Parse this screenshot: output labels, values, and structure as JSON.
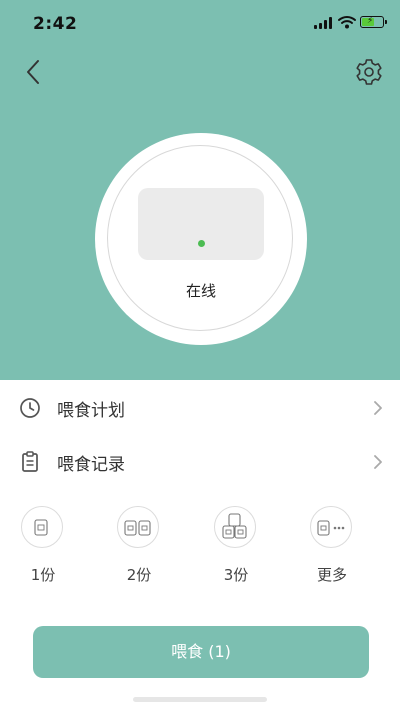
{
  "status_bar": {
    "time": "2:42",
    "icons": [
      "signal-icon",
      "wifi-icon",
      "battery-charging-icon"
    ]
  },
  "header": {
    "back_icon": "back-icon",
    "settings_icon": "gear-icon",
    "accent_color": "#7cbfb1"
  },
  "device": {
    "status": "在线",
    "led_color": "#4cbc52"
  },
  "menu": [
    {
      "label": "喂食计划",
      "icon": "clock-icon"
    },
    {
      "label": "喂食记录",
      "icon": "clipboard-icon"
    }
  ],
  "portions": [
    {
      "label": "1份",
      "icon": "one-bag-icon"
    },
    {
      "label": "2份",
      "icon": "two-bags-icon"
    },
    {
      "label": "3份",
      "icon": "three-bags-icon"
    },
    {
      "label": "更多",
      "icon": "more-bags-icon"
    }
  ],
  "feed_button": {
    "label": "喂食 (1)"
  }
}
